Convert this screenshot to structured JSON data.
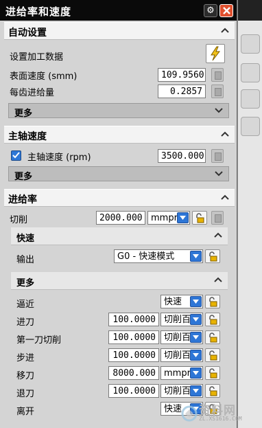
{
  "dialog": {
    "title": "进给率和速度"
  },
  "auto": {
    "header": "自动设置",
    "set_data_label": "设置加工数据",
    "surface_speed_label": "表面速度 (smm)",
    "surface_speed_value": "109.9560",
    "feed_per_tooth_label": "每齿进给量",
    "feed_per_tooth_value": "0.2857",
    "more_label": "更多"
  },
  "spindle": {
    "header": "主轴速度",
    "checkbox_checked": true,
    "speed_label": "主轴速度 (rpm)",
    "speed_value": "3500.000",
    "more_label": "更多"
  },
  "feed": {
    "header": "进给率",
    "cut_label": "切削",
    "cut_value": "2000.000",
    "cut_unit": "mmpr",
    "rapid": {
      "header": "快速",
      "output_label": "输出",
      "output_value": "G0 - 快速模式"
    },
    "more": {
      "header": "更多",
      "rows": [
        {
          "label": "逼近",
          "value": "",
          "unit": "快速"
        },
        {
          "label": "进刀",
          "value": "100.0000",
          "unit": "切削百"
        },
        {
          "label": "第一刀切削",
          "value": "100.0000",
          "unit": "切削百"
        },
        {
          "label": "步进",
          "value": "100.0000",
          "unit": "切削百"
        },
        {
          "label": "移刀",
          "value": "8000.000",
          "unit": "mmpr"
        },
        {
          "label": "退刀",
          "value": "100.0000",
          "unit": "切削百"
        },
        {
          "label": "离开",
          "value": "",
          "unit": "快速"
        }
      ]
    }
  },
  "watermark": {
    "text": "资料网",
    "url": "ZL.XS1616.COM"
  },
  "colors": {
    "titlebar": "#0a0a0a",
    "accent": "#2e76d6",
    "close": "#e0502e",
    "lightning": "#f2c21a"
  }
}
